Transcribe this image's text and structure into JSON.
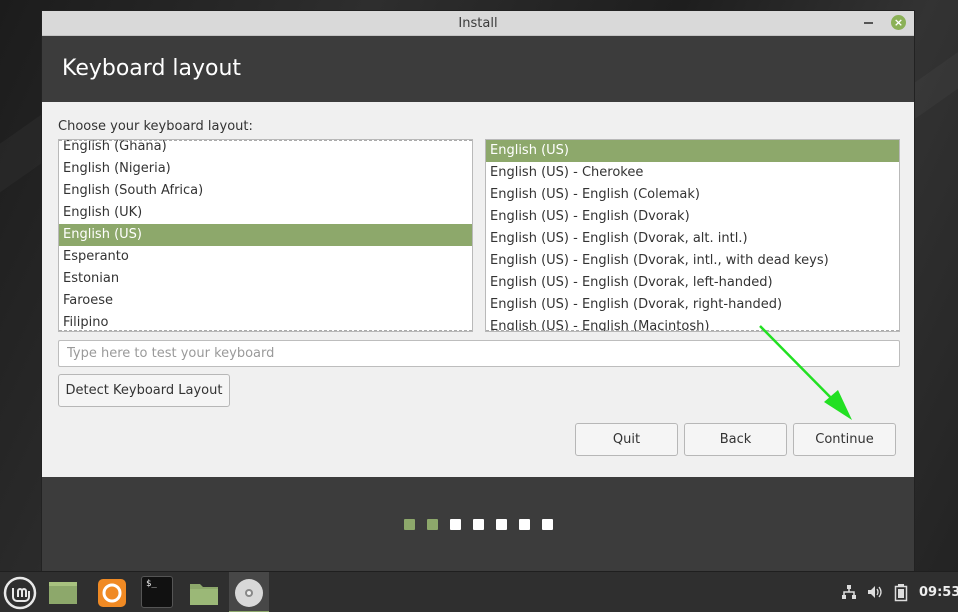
{
  "window": {
    "title": "Install",
    "close_symbol": "×"
  },
  "header": {
    "title": "Keyboard layout"
  },
  "layout_prompt": "Choose your keyboard layout:",
  "layouts": [
    "English (Ghana)",
    "English (Nigeria)",
    "English (South Africa)",
    "English (UK)",
    "English (US)",
    "Esperanto",
    "Estonian",
    "Faroese",
    "Filipino"
  ],
  "selected_layout": "English (US)",
  "variants": [
    "English (US)",
    "English (US) - Cherokee",
    "English (US) - English (Colemak)",
    "English (US) - English (Dvorak)",
    "English (US) - English (Dvorak, alt. intl.)",
    "English (US) - English (Dvorak, intl., with dead keys)",
    "English (US) - English (Dvorak, left-handed)",
    "English (US) - English (Dvorak, right-handed)",
    "English (US) - English (Macintosh)"
  ],
  "selected_variant": "English (US)",
  "test_input": {
    "value": "",
    "placeholder": "Type here to test your keyboard"
  },
  "buttons": {
    "detect": "Detect Keyboard Layout",
    "quit": "Quit",
    "back": "Back",
    "continue": "Continue"
  },
  "progress": {
    "total_steps": 7,
    "completed_steps": 2
  },
  "colors": {
    "accent": "#8da86b",
    "arrow": "#22e022"
  },
  "taskbar": {
    "apps": [
      "mint-menu-icon",
      "show-desktop-icon",
      "firefox-icon",
      "terminal-icon",
      "files-icon",
      "installer-disc-icon"
    ],
    "terminal_glyph": "$_",
    "clock": "09:53"
  }
}
